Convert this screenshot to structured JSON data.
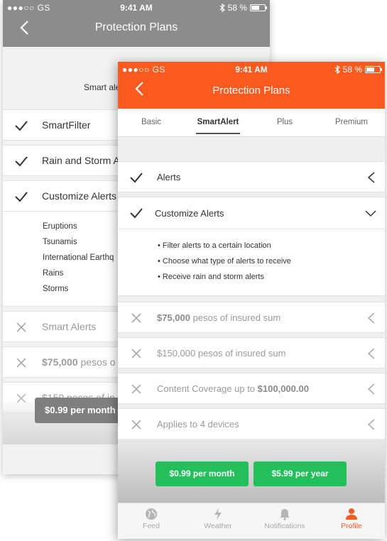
{
  "status_bar": {
    "carrier": "●●●○○ GS",
    "time": "9:41 AM",
    "battery": "58 %"
  },
  "colors": {
    "front_header": "#fa5a1e",
    "back_header": "#8c8c8c",
    "green": "#22c05a",
    "accent": "#fa5a1e"
  },
  "back_screen": {
    "title": "Protection Plans",
    "description_partial": "Smart ale",
    "features": [
      {
        "label": "SmartFilter",
        "included": true
      },
      {
        "label": "Rain and Storm A",
        "included": true
      },
      {
        "label": "Customize Alerts",
        "included": true
      }
    ],
    "sub_items": [
      "Eruptions",
      "Tsunamis",
      "International Earthq",
      "Rains",
      "Storms"
    ],
    "excluded": [
      {
        "label": "Smart Alerts"
      },
      {
        "label_bold": "$75,000",
        "label_rest": " pesos o"
      },
      {
        "label_faded": "$150  pesos of in"
      }
    ],
    "price_button": "$0.99 per month"
  },
  "front_screen": {
    "title": "Protection Plans",
    "tabs": [
      {
        "label": "Basic",
        "active": false
      },
      {
        "label": "SmartAlert",
        "active": true
      },
      {
        "label": "Plus",
        "active": false
      },
      {
        "label": "Premium",
        "active": false
      }
    ],
    "alerts_label": "Alerts",
    "customize_label": "Customize Alerts",
    "bullets": [
      "• Filter alerts to a certain location",
      "• Choose what type of alerts to receive",
      "• Receive rain and storm alerts"
    ],
    "excluded": [
      {
        "bold": "$75,000",
        "rest": " pesos of insured sum"
      },
      {
        "bold": "",
        "rest": "$150,000 pesos of insured sum"
      },
      {
        "rest": "Content Coverage up to ",
        "bold_after": "$100,000.00"
      },
      {
        "bold": "",
        "rest": "Applies to 4 devices"
      }
    ],
    "price_month": "$0.99 per month",
    "price_year": "$5.99 per year",
    "tabbar": [
      {
        "label": "Feed",
        "icon": "globe-icon",
        "active": false
      },
      {
        "label": "Weather",
        "icon": "lightning-icon",
        "active": false
      },
      {
        "label": "Notifications",
        "icon": "bell-icon",
        "active": false
      },
      {
        "label": "Profile",
        "icon": "person-icon",
        "active": true
      }
    ]
  }
}
